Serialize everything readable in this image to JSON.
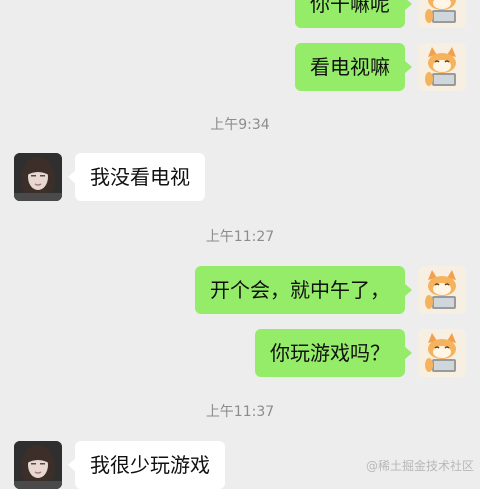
{
  "messages": [
    {
      "sender": "self",
      "text": "你干嘛呢"
    },
    {
      "sender": "self",
      "text": "看电视嘛"
    },
    {
      "sender": "other",
      "text": "我没看电视"
    },
    {
      "sender": "self",
      "text": "开个会，就中午了，"
    },
    {
      "sender": "self",
      "text": "你玩游戏吗？"
    },
    {
      "sender": "other",
      "text": "我很少玩游戏"
    }
  ],
  "timestamps": [
    "上午9:34",
    "上午11:27",
    "上午11:37"
  ],
  "watermark": "@稀土掘金技术社区",
  "colors": {
    "background": "#ededed",
    "self_bubble": "#95ec69",
    "other_bubble": "#ffffff",
    "timestamp_text": "#8c8c8c"
  },
  "avatars": {
    "self": "cartoon-cat-avatar",
    "other": "girl-photo-avatar"
  }
}
